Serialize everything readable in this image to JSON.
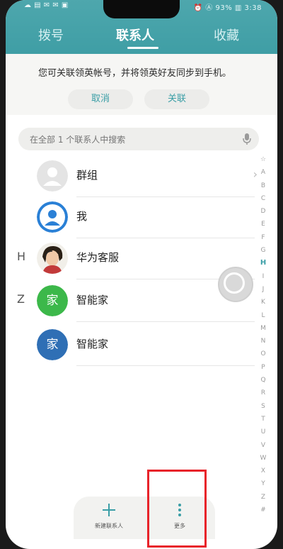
{
  "status_bar": {
    "left": "☁ ▤ ✉ ✉ ▣",
    "right": "⏰ Ⓐ 93% ▥ 3:38"
  },
  "tabs": [
    {
      "label": "拨号"
    },
    {
      "label": "联系人"
    },
    {
      "label": "收藏"
    }
  ],
  "banner": {
    "text": "您可关联领英帐号，并将领英好友同步到手机。",
    "cancel": "取消",
    "link": "关联"
  },
  "search": {
    "placeholder": "在全部 1 个联系人中搜索"
  },
  "contacts": [
    {
      "section": "",
      "name": "群组"
    },
    {
      "section": "",
      "name": "我"
    },
    {
      "section": "H",
      "name": "华为客服"
    },
    {
      "section": "Z",
      "name": "智能家",
      "avatar_text": "家",
      "avatar_color": "#3cb84a"
    },
    {
      "section": "",
      "name": "智能家",
      "avatar_text": "家",
      "avatar_color": "#2f6fb5"
    }
  ],
  "index_letters": [
    "☆",
    "A",
    "B",
    "C",
    "D",
    "E",
    "F",
    "G",
    "H",
    "I",
    "J",
    "K",
    "L",
    "M",
    "N",
    "O",
    "P",
    "Q",
    "R",
    "S",
    "T",
    "U",
    "V",
    "W",
    "X",
    "Y",
    "Z",
    "#"
  ],
  "active_letter": "H",
  "bottom": {
    "new_contact": "新建联系人",
    "more": "更多"
  },
  "colors": {
    "accent": "#3a9ea6",
    "header": "#4ea7ad",
    "highlight": "#e8232a"
  }
}
